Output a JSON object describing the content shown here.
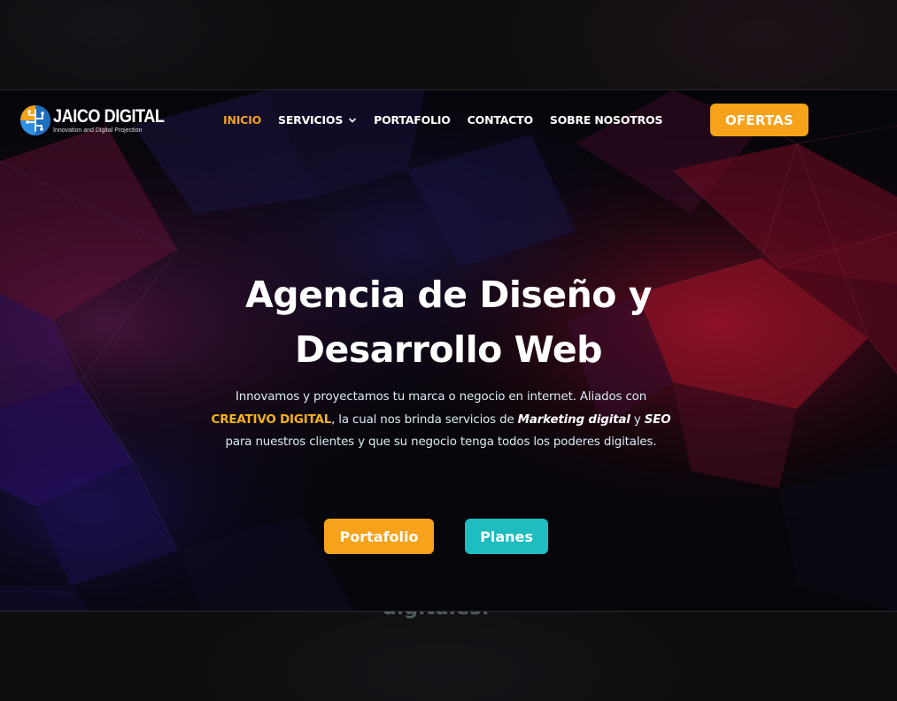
{
  "brand": {
    "name": "JAICO DIGITAL",
    "tagline": "Innovation and Digital Projection"
  },
  "nav": {
    "items": [
      {
        "label": "INICIO",
        "active": true
      },
      {
        "label": "SERVICIOS",
        "has_dropdown": true
      },
      {
        "label": "PORTAFOLIO"
      },
      {
        "label": "CONTACTO"
      },
      {
        "label": "SOBRE NOSOTROS"
      }
    ],
    "offers_button": "OFERTAS"
  },
  "hero": {
    "title_line1": "Agencia de Diseño y",
    "title_line2": "Desarrollo Web",
    "desc_part1": "Innovamos y proyectamos tu marca o negocio en internet. Aliados con ",
    "desc_highlight1": "CREATIVO DIGITAL",
    "desc_part2": ", la cual nos brinda servicios de ",
    "desc_highlight2": "Marketing digital",
    "desc_part3": " y ",
    "desc_highlight3": "SEO",
    "desc_part4": " para nuestros clientes y que su negocio tenga todos los poderes digitales.",
    "cta_portfolio": "Portafolio",
    "cta_plans": "Planes"
  },
  "background": {
    "ghost_text": "digitales."
  },
  "colors": {
    "accent_orange": "#f6a21a",
    "accent_teal": "#1fbcc0",
    "highlight_yellow": "#f6b21a",
    "text_light_cyan": "#d9eef3"
  }
}
